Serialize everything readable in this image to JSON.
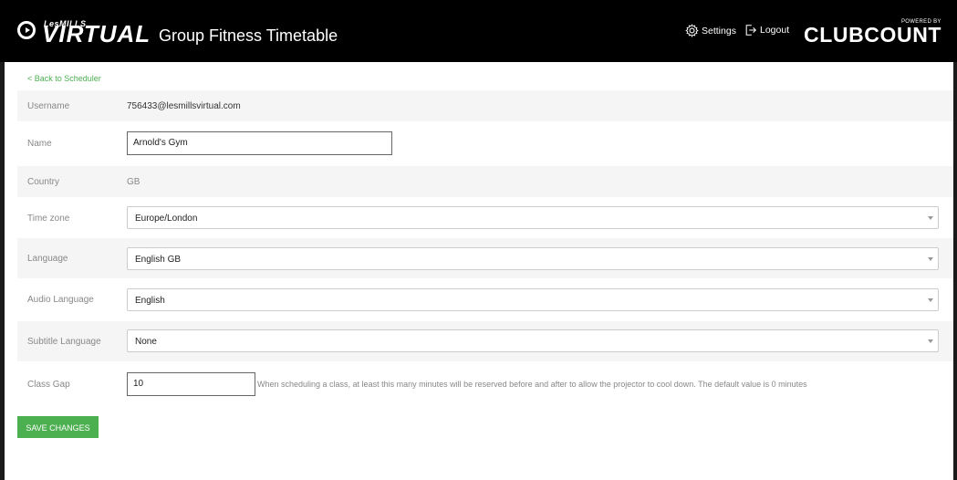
{
  "header": {
    "brand_small": "LesMILLS",
    "brand_large": "VIRTUAL",
    "app_title": "Group Fitness Timetable",
    "settings_label": "Settings",
    "logout_label": "Logout",
    "powered_by": "POWERED BY",
    "partner": "CLUBCOUNT",
    "icons": {
      "settings": "gear-icon",
      "logout": "logout-icon",
      "logo": "play-circle-icon"
    }
  },
  "nav": {
    "back_label": "< Back to Scheduler"
  },
  "form": {
    "username": {
      "label": "Username",
      "value": "756433@lesmillsvirtual.com"
    },
    "name": {
      "label": "Name",
      "value": "Arnold's Gym"
    },
    "country": {
      "label": "Country",
      "value": "GB"
    },
    "timezone": {
      "label": "Time zone",
      "value": "Europe/London"
    },
    "language": {
      "label": "Language",
      "value": "English GB"
    },
    "audio_language": {
      "label": "Audio Language",
      "value": "English"
    },
    "subtitle_language": {
      "label": "Subtitle Language",
      "value": "None"
    },
    "class_gap": {
      "label": "Class Gap",
      "value": "10",
      "hint": "When scheduling a class, at least this many minutes will be reserved before and after to allow the projector to cool down. The default value is 0 minutes"
    },
    "save_label": "SAVE CHANGES"
  },
  "colors": {
    "accent": "#4caf50",
    "header_bg": "#000000",
    "row_shade": "#f5f5f5"
  }
}
